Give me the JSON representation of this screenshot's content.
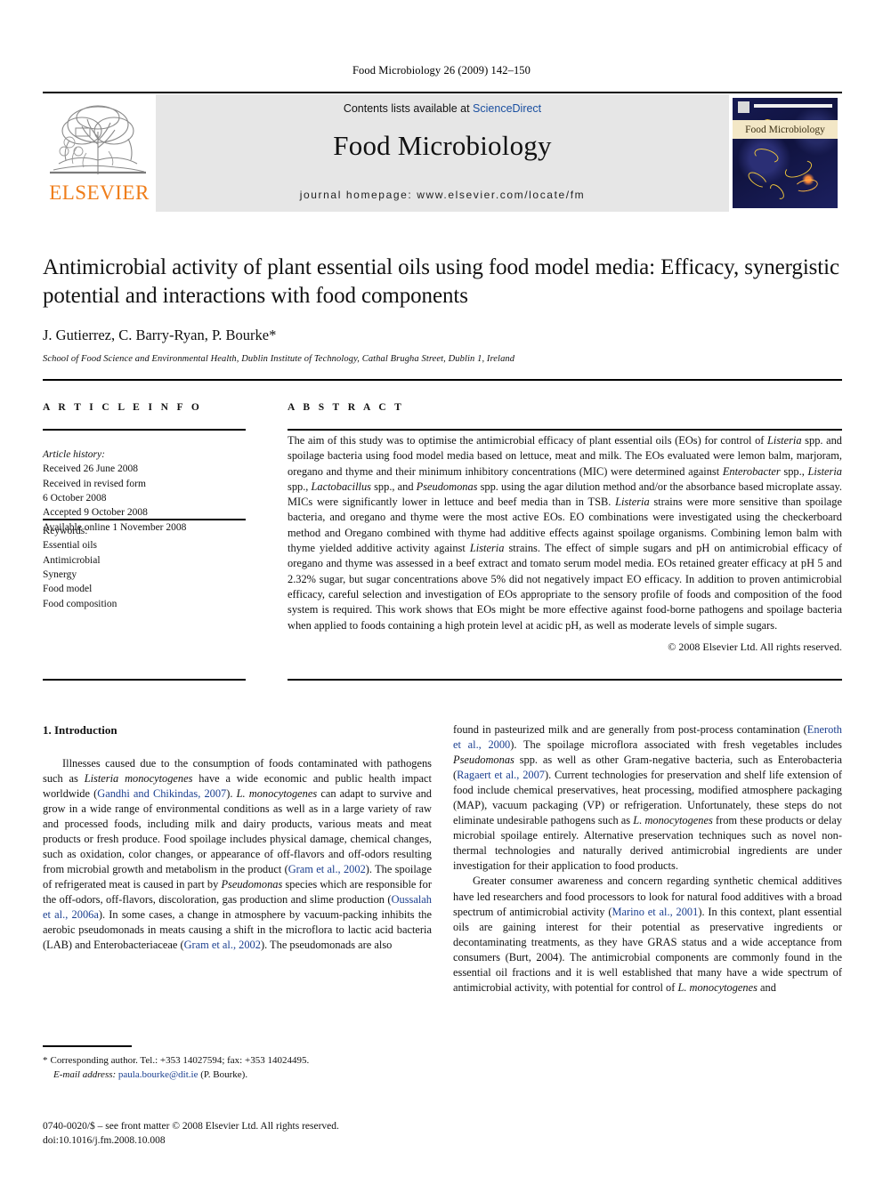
{
  "running_head": "Food Microbiology 26 (2009) 142–150",
  "masthead": {
    "contents_prefix": "Contents lists available at ",
    "sciencedirect": "ScienceDirect",
    "journal_title": "Food Microbiology",
    "homepage": "journal homepage: www.elsevier.com/locate/fm",
    "publisher_name": "ELSEVIER",
    "cover_title": "Food Microbiology",
    "accent_orange": "#ef7d1a",
    "link_blue": "#1a4fa0",
    "band_grey": "#e6e6e6"
  },
  "article": {
    "title": "Antimicrobial activity of plant essential oils using food model media: Efficacy, synergistic potential and interactions with food components",
    "authors": "J. Gutierrez, C. Barry-Ryan, P. Bourke*",
    "affiliation": "School of Food Science and Environmental Health, Dublin Institute of Technology, Cathal Brugha Street, Dublin 1, Ireland"
  },
  "article_info": {
    "heading": "A R T I C L E  I N F O",
    "history_label": "Article history:",
    "history": [
      "Received 26 June 2008",
      "Received in revised form",
      "6 October 2008",
      "Accepted 9 October 2008",
      "Available online 1 November 2008"
    ],
    "keywords_label": "Keywords:",
    "keywords": [
      "Essential oils",
      "Antimicrobial",
      "Synergy",
      "Food model",
      "Food composition"
    ]
  },
  "abstract": {
    "heading": "A B S T R A C T",
    "p1_a": "The aim of this study was to optimise the antimicrobial efficacy of plant essential oils (EOs) for control of ",
    "listeria_1": "Listeria",
    "p1_b": " spp. and spoilage bacteria using food model media based on lettuce, meat and milk. The EOs evaluated were lemon balm, marjoram, oregano and thyme and their minimum inhibitory concentrations (MIC) were determined against ",
    "enterobacter": "Enterobacter",
    "p1_c": " spp., ",
    "listeria_2": "Listeria",
    "p1_d": " spp., ",
    "lactobacillus": "Lactobacillus",
    "p1_e": " spp., and ",
    "pseudomonas": "Pseudomonas",
    "p1_f": " spp. using the agar dilution method and/or the absorbance based microplate assay. MICs were significantly lower in lettuce and beef media than in TSB. ",
    "listeria_3": "Listeria",
    "p1_g": " strains were more sensitive than spoilage bacteria, and oregano and thyme were the most active EOs. EO combinations were investigated using the checkerboard method and Oregano combined with thyme had additive effects against spoilage organisms. Combining lemon balm with thyme yielded additive activity against ",
    "listeria_4": "Listeria",
    "p1_h": " strains. The effect of simple sugars and pH on antimicrobial efficacy of oregano and thyme was assessed in a beef extract and tomato serum model media. EOs retained greater efficacy at pH 5 and 2.32% sugar, but sugar concentrations above 5% did not negatively impact EO efficacy. In addition to proven antimicrobial efficacy, careful selection and investigation of EOs appropriate to the sensory profile of foods and composition of the food system is required. This work shows that EOs might be more effective against food-borne pathogens and spoilage bacteria when applied to foods containing a high protein level at acidic pH, as well as moderate levels of simple sugars.",
    "copyright": "© 2008 Elsevier Ltd. All rights reserved."
  },
  "introduction": {
    "heading": "1. Introduction",
    "left": {
      "p1_a": "Illnesses caused due to the consumption of foods contaminated with pathogens such as ",
      "lm_1": "Listeria monocytogenes",
      "p1_b": " have a wide economic and public health impact worldwide (",
      "cite_gandhi": "Gandhi and Chikindas, 2007",
      "p1_c": "). ",
      "lm_2": "L. monocytogenes",
      "p1_d": " can adapt to survive and grow in a wide range of environmental conditions as well as in a large variety of raw and processed foods, including milk and dairy products, various meats and meat products or fresh produce. Food spoilage includes physical damage, chemical changes, such as oxidation, color changes, or appearance of off-flavors and off-odors resulting from microbial growth and metabolism in the product (",
      "cite_gram1": "Gram et al., 2002",
      "p1_e": "). The spoilage of refrigerated meat is caused in part by ",
      "pseudomonas": "Pseudomonas",
      "p1_f": " species which are responsible for the off-odors, off-flavors, discoloration, gas production and slime production (",
      "cite_oussalah": "Oussalah et al., 2006a",
      "p1_g": "). In some cases, a change in atmosphere by vacuum-packing inhibits the aerobic pseudomonads in meats causing a shift in the microflora to lactic acid bacteria (LAB) and Enterobacteriaceae (",
      "cite_gram2": "Gram et al., 2002",
      "p1_h": "). The pseudomonads are also"
    },
    "right": {
      "p1_a": "found in pasteurized milk and are generally from post-process contamination (",
      "cite_eneroth": "Eneroth et al., 2000",
      "p1_b": "). The spoilage microflora associated with fresh vegetables includes ",
      "pseudomonas": "Pseudomonas",
      "p1_c": " spp. as well as other Gram-negative bacteria, such as Enterobacteria (",
      "cite_ragaert": "Ragaert et al., 2007",
      "p1_d": "). Current technologies for preservation and shelf life extension of food include chemical preservatives, heat processing, modified atmosphere packaging (MAP), vacuum packaging (VP) or refrigeration. Unfortunately, these steps do not eliminate undesirable pathogens such as ",
      "lm_1": "L. monocytogenes",
      "p1_e": " from these products or delay microbial spoilage entirely. Alternative preservation techniques such as novel non-thermal technologies and naturally derived antimicrobial ingredients are under investigation for their application to food products.",
      "p2_a": "Greater consumer awareness and concern regarding synthetic chemical additives have led researchers and food processors to look for natural food additives with a broad spectrum of antimicrobial activity (",
      "cite_marino": "Marino et al., 2001",
      "p2_b": "). In this context, plant essential oils are gaining interest for their potential as preservative ingredients or decontaminating treatments, as they have GRAS status and a wide acceptance from consumers (Burt, 2004). The antimicrobial components are commonly found in the essential oil fractions and it is well established that many have a wide spectrum of antimicrobial activity, with potential for control of ",
      "lm_2": "L. monocytogenes",
      "p2_c": " and"
    }
  },
  "footnote": {
    "star": "*",
    "corresponding": "Corresponding author. Tel.: +353 14027594; fax: +353 14024495.",
    "email_label": "E-mail address:",
    "email": "paula.bourke@dit.ie",
    "email_owner": "(P. Bourke)."
  },
  "imprint": {
    "line1": "0740-0020/$ – see front matter © 2008 Elsevier Ltd. All rights reserved.",
    "line2": "doi:10.1016/j.fm.2008.10.008"
  }
}
